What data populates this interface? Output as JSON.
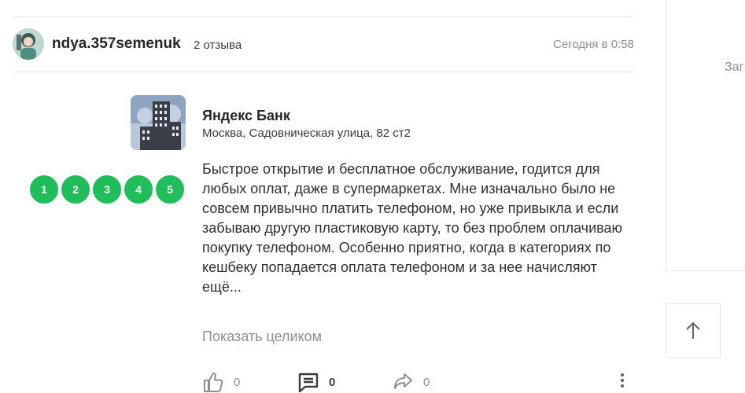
{
  "review": {
    "username": "ndya.357semenuk",
    "reviews_count": "2 отзыва",
    "date": "Сегодня в 0:58",
    "rating_steps": [
      "1",
      "2",
      "3",
      "4",
      "5"
    ],
    "rating_color": "#1fbe5b",
    "text": "Быстрое открытие и бесплатное обслуживание, годится для любых оплат, даже в супермаркетах. Мне изначально было не совсем привычно платить телефоном, но уже привыкла и если забываю другую пластиковую карту, то без проблем оплачиваю покупку телефоном. Особенно приятно, когда в категориях по кешбеку попадается оплата телефоном и за нее начисляют ещё...",
    "show_full": "Показать целиком",
    "actions": {
      "likes": "0",
      "comments": "0",
      "shares": "0"
    }
  },
  "organization": {
    "name": "Яндекс Банк",
    "address": "Москва, Садовническая улица, 82 ст2"
  },
  "sidebar": {
    "partial_text": "Заг"
  }
}
